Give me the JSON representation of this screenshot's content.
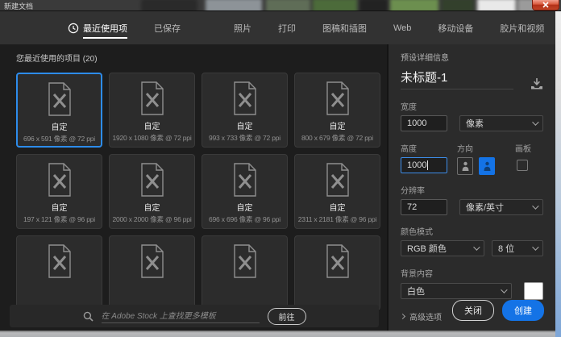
{
  "window": {
    "title": "新建文档"
  },
  "tabs": [
    {
      "label": "最近使用项",
      "active": true
    },
    {
      "label": "已保存"
    },
    {
      "label": "照片"
    },
    {
      "label": "打印"
    },
    {
      "label": "图稿和插图"
    },
    {
      "label": "Web"
    },
    {
      "label": "移动设备"
    },
    {
      "label": "胶片和视频"
    }
  ],
  "recent": {
    "heading": "您最近使用的项目 (20)",
    "cards": [
      {
        "title": "自定",
        "dims": "696 x 591 像素 @ 72 ppi",
        "selected": true
      },
      {
        "title": "自定",
        "dims": "1920 x 1080 像素 @ 72 ppi"
      },
      {
        "title": "自定",
        "dims": "993 x 733 像素 @ 72 ppi"
      },
      {
        "title": "自定",
        "dims": "800 x 679 像素 @ 72 ppi"
      },
      {
        "title": "自定",
        "dims": "197 x 121 像素 @ 96 ppi"
      },
      {
        "title": "自定",
        "dims": "2000 x 2000 像素 @ 96 ppi"
      },
      {
        "title": "自定",
        "dims": "696 x 696 像素 @ 96 ppi"
      },
      {
        "title": "自定",
        "dims": "2311 x 2181 像素 @ 96 ppi"
      }
    ],
    "partial_cards_visible": 4
  },
  "search": {
    "placeholder": "在 Adobe Stock 上查找更多模板",
    "go_label": "前往"
  },
  "panel": {
    "heading": "预设详细信息",
    "doc_name": "未标题-1",
    "width_label": "宽度",
    "width_value": "1000",
    "width_unit": "像素",
    "height_label": "高度",
    "height_value": "1000",
    "orientation_label": "方向",
    "artboard_label": "画板",
    "resolution_label": "分辨率",
    "resolution_value": "72",
    "resolution_unit": "像素/英寸",
    "color_mode_label": "颜色模式",
    "color_mode_value": "RGB 颜色",
    "bit_depth_value": "8 位",
    "background_label": "背景内容",
    "background_value": "白色",
    "advanced_label": "高级选项",
    "close_label": "关闭",
    "create_label": "创建"
  },
  "icons": {
    "clock": "clock-icon",
    "search": "magnifier-icon",
    "save_preset": "download-tray-icon",
    "document_placeholder": "document-x-icon",
    "orientation_portrait": "portrait-person-icon",
    "orientation_landscape": "landscape-person-icon",
    "window_close": "close-x-icon"
  },
  "colors": {
    "accent": "#1473e6",
    "selection_border": "#2d8ceb",
    "background_swatch": "#ffffff",
    "active_tab_underline": "#ffffff"
  }
}
